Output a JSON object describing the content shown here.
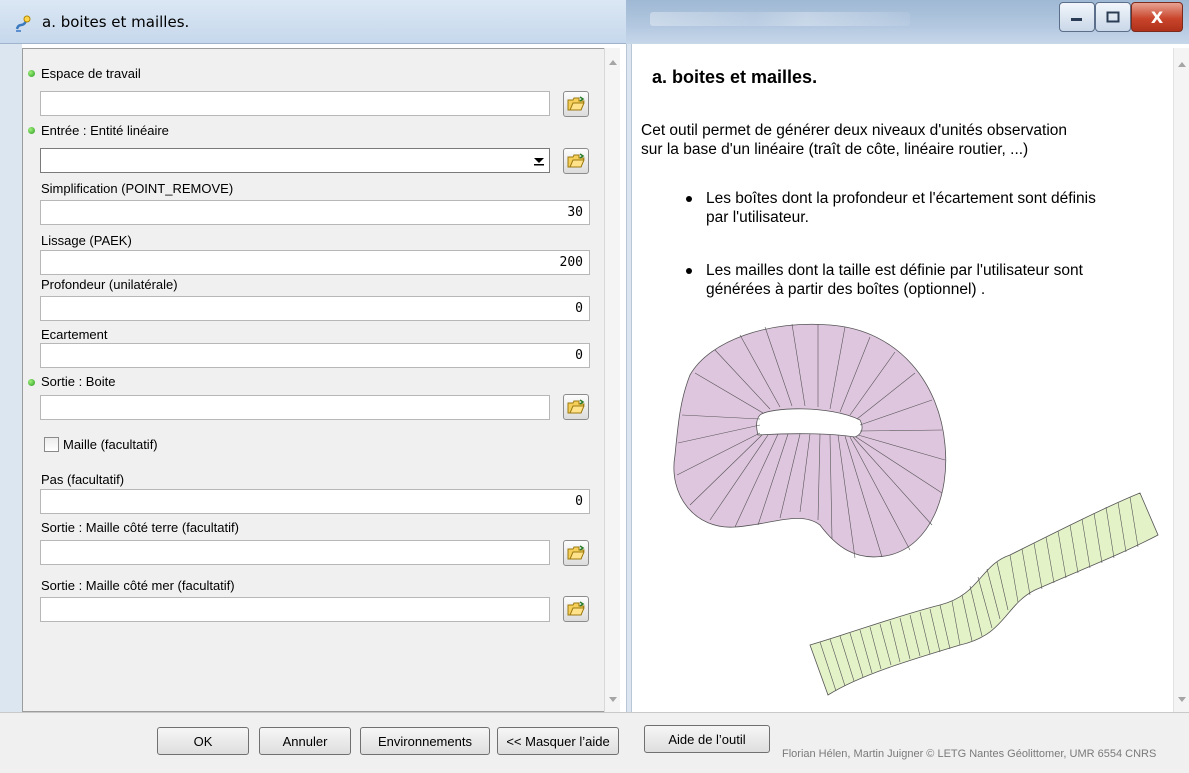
{
  "window": {
    "title": "a. boites et mailles.",
    "minimize_icon": "minimize-icon",
    "maximize_icon": "maximize-icon",
    "close_label": "X"
  },
  "form": {
    "workspace": {
      "label": "Espace de travail",
      "value": ""
    },
    "input_line": {
      "label": "Entrée : Entité linéaire",
      "value": ""
    },
    "simplification": {
      "label": "Simplification (POINT_REMOVE)",
      "value": "30"
    },
    "smoothing": {
      "label": "Lissage (PAEK)",
      "value": "200"
    },
    "depth": {
      "label": "Profondeur (unilatérale)",
      "value": "0"
    },
    "spacing": {
      "label": "Ecartement",
      "value": "0"
    },
    "output_box": {
      "label": "Sortie : Boite",
      "value": ""
    },
    "mesh_checkbox": {
      "label": "Maille (facultatif)",
      "checked": false
    },
    "step": {
      "label": "Pas (facultatif)",
      "value": "0"
    },
    "output_mesh_land": {
      "label": "Sortie : Maille côté terre (facultatif)",
      "value": ""
    },
    "output_mesh_sea": {
      "label": "Sortie : Maille côté mer (facultatif)",
      "value": ""
    }
  },
  "help": {
    "title": "a. boites et mailles.",
    "intro_line1": "Cet outil permet de générer deux niveaux d'unités observation",
    "intro_line2": "sur la base d'un linéaire (traît de côte, linéaire routier, ...)",
    "bullet1_line1": "Les boîtes dont la profondeur et l'écartement sont définis",
    "bullet1_line2": "par l'utilisateur.",
    "bullet2_line1": "Les mailles dont la taille est définie par l'utilisateur sont",
    "bullet2_line2": "générées à partir des boîtes (optionnel) .",
    "box_fill": "#dfc6df",
    "mesh_fill": "#e4f2c8"
  },
  "buttons": {
    "ok": "OK",
    "cancel": "Annuler",
    "environments": "Environnements",
    "hide_help": "<< Masquer l’aide",
    "tool_help": "Aide de l’outil"
  },
  "footer": {
    "credits": "Florian Hélen, Martin Juigner © LETG Nantes Géolittomer, UMR 6554 CNRS"
  }
}
